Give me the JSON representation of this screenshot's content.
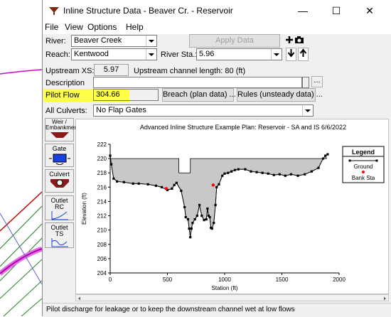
{
  "window": {
    "title": "Inline Structure Data - Beaver Cr. - Reservoir",
    "controls": {
      "minimize": "—",
      "maximize": "☐",
      "close": "✕"
    }
  },
  "menu": [
    "File",
    "View",
    "Options",
    "Help"
  ],
  "river": {
    "label": "River:",
    "value": "Beaver Creek"
  },
  "apply_button": "Apply Data",
  "reach": {
    "label": "Reach:",
    "value": "Kentwood"
  },
  "river_sta": {
    "label": "River Sta.:",
    "value": "5.96"
  },
  "upstream": {
    "label": "Upstream XS:",
    "value": "5.97",
    "length_text": "Upstream channel length: 80 (ft)"
  },
  "description": {
    "label": "Description",
    "value": ""
  },
  "ellipsis_button": "...",
  "pilot_flow": {
    "label": "Pilot Flow",
    "value": "304.66"
  },
  "breach_button": "Breach (plan data) ...",
  "rules_button": "Rules (unsteady data) ...",
  "all_culverts": {
    "label": "All Culverts:",
    "value": "No Flap Gates"
  },
  "toolbar": {
    "weir": "Weir / Embankment",
    "gate": "Gate",
    "culvert": "Culvert",
    "outlet_rc": "Outlet RC",
    "outlet_ts": "Outlet TS"
  },
  "statusbar": "Pilot discharge for leakage or to keep the downstream channel wet at low flows",
  "colors": {
    "highlight": "#ffff44",
    "ground_fill": "#c8c8c8",
    "bank_sta": "#ff0000",
    "points": "#000000"
  },
  "chart_data": {
    "type": "area",
    "title": "Advanced Inline  Structure Example      Plan: Reservoir - SA and IS    6/6/2022",
    "xlabel": "Station (ft)",
    "ylabel": "Elevation (ft)",
    "xlim": [
      0,
      2000
    ],
    "ylim": [
      204,
      222
    ],
    "xticks": [
      0,
      500,
      1000,
      1500,
      2000
    ],
    "yticks": [
      204,
      206,
      208,
      210,
      212,
      214,
      216,
      218,
      220,
      222
    ],
    "legend": {
      "title": "Legend",
      "entries": [
        "Ground",
        "Bank Sta"
      ],
      "placement": "top-right"
    },
    "ground": [
      [
        0,
        220.4
      ],
      [
        10,
        219.2
      ],
      [
        30,
        217.2
      ],
      [
        60,
        216.8
      ],
      [
        120,
        216.7
      ],
      [
        200,
        216.5
      ],
      [
        250,
        216.5
      ],
      [
        330,
        216.4
      ],
      [
        400,
        216.2
      ],
      [
        450,
        216.0
      ],
      [
        500,
        215.6
      ],
      [
        540,
        215.8
      ],
      [
        560,
        216.3
      ],
      [
        580,
        216.6
      ],
      [
        620,
        215.5
      ],
      [
        650,
        213.2
      ],
      [
        660,
        211.8
      ],
      [
        680,
        211.5
      ],
      [
        690,
        210.2
      ],
      [
        700,
        209.0
      ],
      [
        710,
        210.2
      ],
      [
        720,
        211.0
      ],
      [
        740,
        211.5
      ],
      [
        760,
        212.0
      ],
      [
        780,
        213.5
      ],
      [
        800,
        212.0
      ],
      [
        820,
        211.4
      ],
      [
        840,
        211.5
      ],
      [
        850,
        213.0
      ],
      [
        860,
        212.0
      ],
      [
        870,
        211.8
      ],
      [
        880,
        210.3
      ],
      [
        890,
        210.2
      ],
      [
        905,
        211.0
      ],
      [
        920,
        213.5
      ],
      [
        930,
        216.0
      ],
      [
        950,
        216.4
      ],
      [
        980,
        217.6
      ],
      [
        1000,
        217.9
      ],
      [
        1030,
        218.0
      ],
      [
        1060,
        218.2
      ],
      [
        1090,
        218.4
      ],
      [
        1120,
        218.5
      ],
      [
        1180,
        218.5
      ],
      [
        1230,
        218.2
      ],
      [
        1280,
        218.1
      ],
      [
        1330,
        218.0
      ],
      [
        1380,
        217.9
      ],
      [
        1430,
        217.7
      ],
      [
        1480,
        217.8
      ],
      [
        1530,
        217.6
      ],
      [
        1580,
        217.8
      ],
      [
        1640,
        217.6
      ],
      [
        1700,
        217.8
      ],
      [
        1760,
        218.2
      ],
      [
        1820,
        218.7
      ],
      [
        1860,
        220.0
      ],
      [
        1880,
        220.4
      ],
      [
        1900,
        220.6
      ]
    ],
    "deck": {
      "high_chord": 220.0,
      "notch_elevation": 218.0,
      "notch_x": [
        600,
        700
      ],
      "x_range": [
        0,
        1890
      ]
    },
    "bank_stations": [
      [
        490,
        215.8
      ],
      [
        900,
        216.3
      ]
    ]
  }
}
